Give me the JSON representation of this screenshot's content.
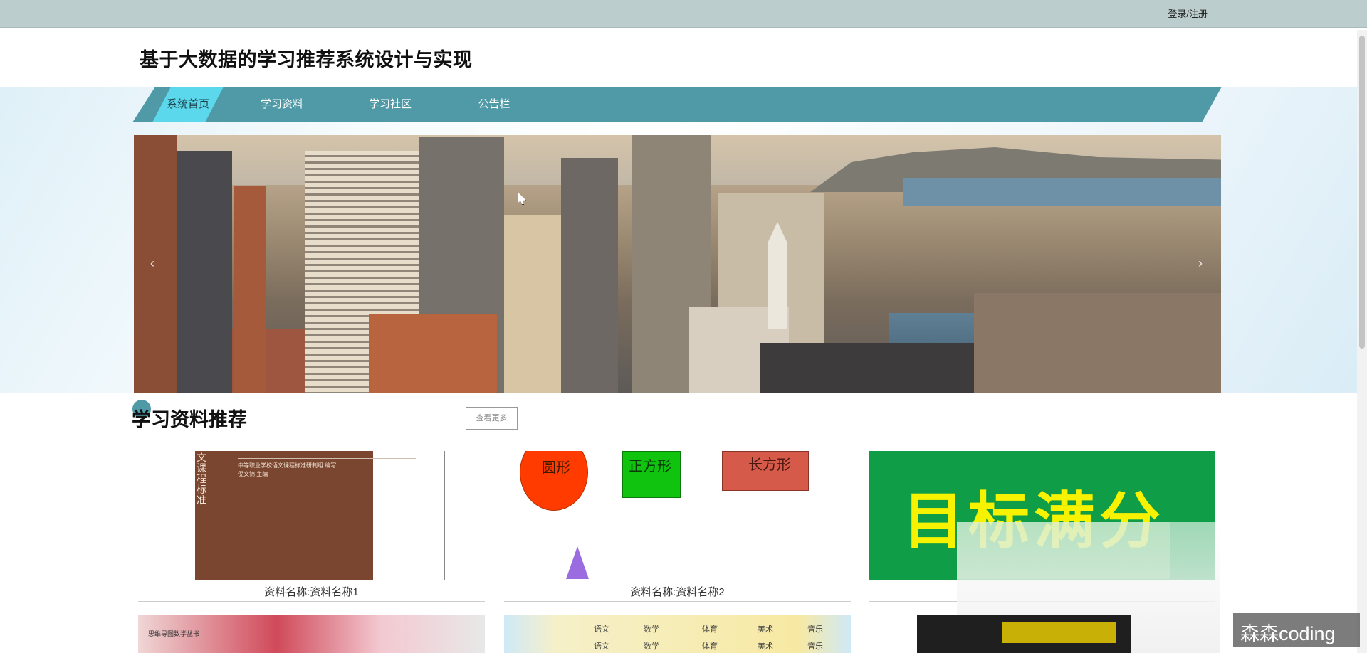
{
  "topbar": {
    "login_label": "登录/注册"
  },
  "header": {
    "title": "基于大数据的学习推荐系统设计与实现"
  },
  "nav": {
    "items": [
      {
        "label": "系统首页",
        "active": true
      },
      {
        "label": "学习资料",
        "active": false
      },
      {
        "label": "学习社区",
        "active": false
      },
      {
        "label": "公告栏",
        "active": false
      }
    ]
  },
  "banner": {
    "prev_icon": "‹",
    "next_icon": "›"
  },
  "section": {
    "title": "学习资料推荐",
    "more_label": "查看更多"
  },
  "cards": [
    {
      "name": "资料名称:资料名称1",
      "spine_text": "文课程标准",
      "publisher": "中等职业学校语文课程标准研制组 编写",
      "author": "倪文锦 主编"
    },
    {
      "name": "资料名称:资料名称2",
      "shapes": [
        "圆形",
        "正方形",
        "长方形"
      ]
    },
    {
      "name": "",
      "banner_text": "目标满分"
    }
  ],
  "row2": {
    "a_label": "思维导图数学丛书",
    "b_cells": [
      "语文",
      "数学",
      "体育",
      "美术",
      "音乐",
      "语文",
      "数学",
      "体育",
      "美术",
      "音乐"
    ]
  },
  "watermark": "森森coding",
  "colors": {
    "nav": "#4f9aa6",
    "nav_active": "#5bd8ec",
    "topbar": "#bccdcd"
  }
}
